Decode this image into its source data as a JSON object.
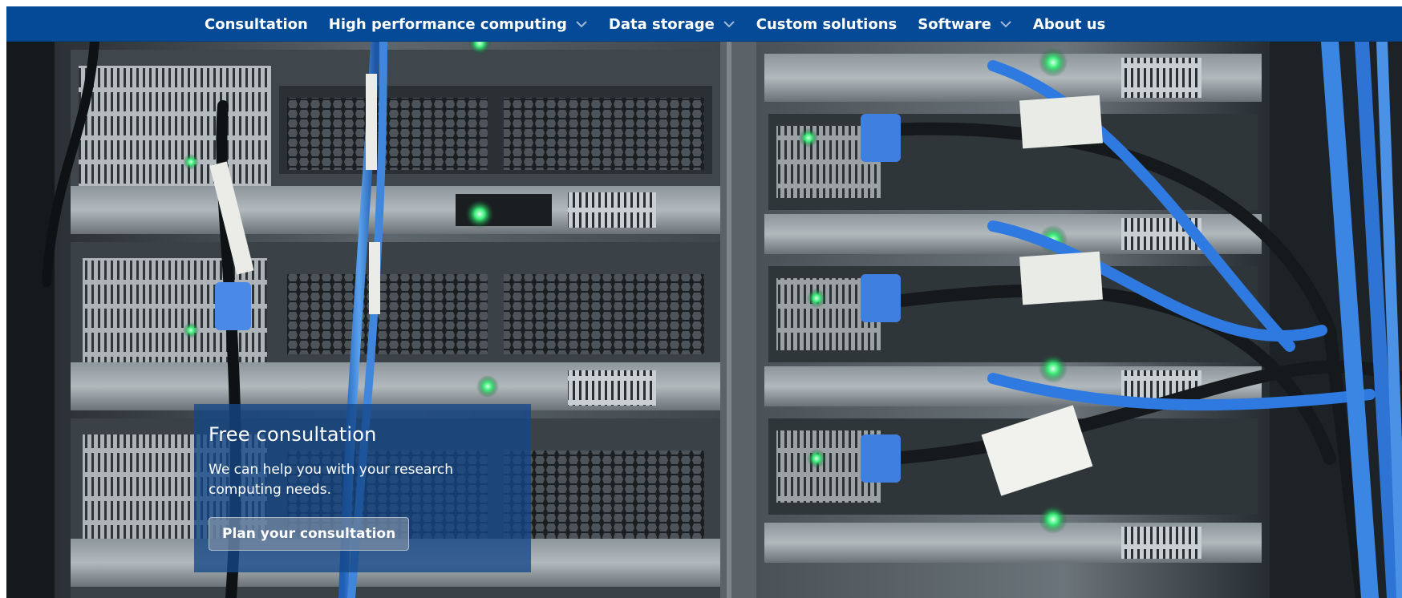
{
  "nav": {
    "items": [
      {
        "label": "Consultation",
        "dropdown": false
      },
      {
        "label": "High performance computing",
        "dropdown": true
      },
      {
        "label": "Data storage",
        "dropdown": true
      },
      {
        "label": "Custom solutions",
        "dropdown": false
      },
      {
        "label": "Software",
        "dropdown": true
      },
      {
        "label": "About us",
        "dropdown": false
      }
    ],
    "chevron_icon": "chevron-down-icon",
    "background": "#044a96"
  },
  "hero": {
    "image_subject": "server rack with blue network cables",
    "card": {
      "title": "Free consultation",
      "body": "We can help you with your research computing needs.",
      "button_label": "Plan your consultation"
    }
  }
}
